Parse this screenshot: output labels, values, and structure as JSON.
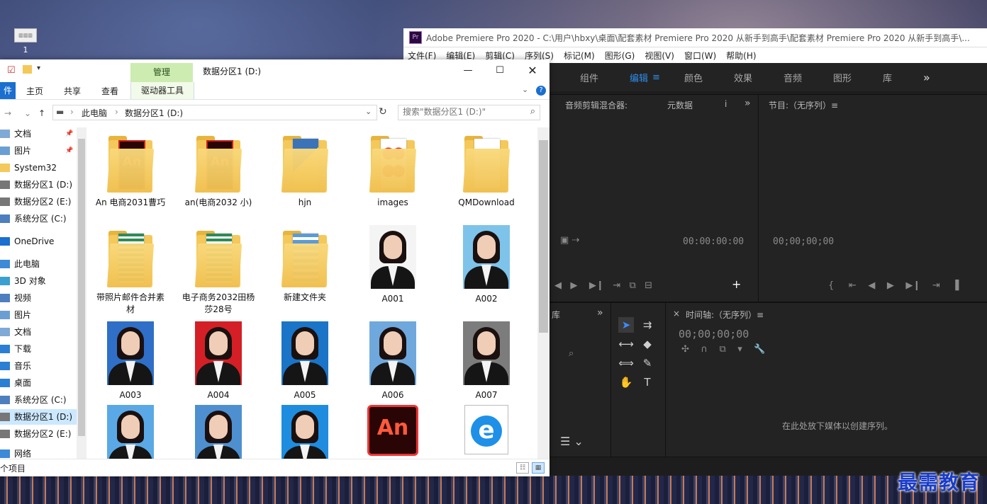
{
  "desktop": {
    "icon_label": "1",
    "watermark": "最需教育"
  },
  "premiere": {
    "window_title": "Adobe Premiere Pro 2020 - C:\\用户\\hbxy\\桌面\\配套素材 Premiere Pro 2020 从新手到高手\\配套素材 Premiere Pro 2020 从新手到高手\\...",
    "logo_text": "Pr",
    "menu": [
      "文件(F)",
      "编辑(E)",
      "剪辑(C)",
      "序列(S)",
      "标记(M)",
      "图形(G)",
      "视图(V)",
      "窗口(W)",
      "帮助(H)"
    ],
    "workspaces": [
      "组件",
      "编辑",
      "颜色",
      "效果",
      "音频",
      "图形",
      "库"
    ],
    "active_workspace": "编辑",
    "more_glyph": "»",
    "source_tabs": {
      "audio_mixer": "音频剪辑混合器:",
      "metadata": "元数据"
    },
    "program_tab": "节目:（无序列）≡",
    "source_timecode": "00:00:00:00",
    "program_timecode": "00;00;00;00",
    "project_tab": "库",
    "timeline_tab": "时间轴:（无序列）≡",
    "timeline_timecode": "00;00;00;00",
    "drop_hint": "在此处放下媒体以创建序列。"
  },
  "explorer": {
    "manage_tab": "管理",
    "title": "数据分区1 (D:)",
    "ribbon": {
      "file": "件",
      "home": "主页",
      "share": "共享",
      "view": "查看",
      "drive_tools": "驱动器工具"
    },
    "breadcrumb": [
      "此电脑",
      "数据分区1 (D:)"
    ],
    "search_placeholder": "搜索\"数据分区1 (D:)\"",
    "nav": [
      {
        "label": "文档",
        "icon": "document-icon",
        "color": "#7fa9d6"
      },
      {
        "label": "图片",
        "icon": "picture-icon",
        "color": "#6b9fd4"
      },
      {
        "label": "System32",
        "icon": "folder-icon",
        "color": "#f5c85a"
      },
      {
        "label": "数据分区1 (D:)",
        "icon": "drive-icon",
        "color": "#777777"
      },
      {
        "label": "数据分区2 (E:)",
        "icon": "drive-icon",
        "color": "#777777"
      },
      {
        "label": "系统分区 (C:)",
        "icon": "drive-icon",
        "color": "#4d7fbf"
      },
      {
        "label": "OneDrive",
        "icon": "cloud-icon",
        "color": "#1a6fcf"
      },
      {
        "label": "此电脑",
        "icon": "computer-icon",
        "color": "#3c8ad8"
      },
      {
        "label": "3D 对象",
        "icon": "cube-icon",
        "color": "#3aa0d0"
      },
      {
        "label": "视频",
        "icon": "video-icon",
        "color": "#4d7fbf"
      },
      {
        "label": "图片",
        "icon": "picture-icon",
        "color": "#6b9fd4"
      },
      {
        "label": "文档",
        "icon": "document-icon",
        "color": "#7fa9d6"
      },
      {
        "label": "下载",
        "icon": "download-icon",
        "color": "#2a7fd4"
      },
      {
        "label": "音乐",
        "icon": "music-icon",
        "color": "#2a7fd4"
      },
      {
        "label": "桌面",
        "icon": "desktop-icon",
        "color": "#2a7fd4"
      },
      {
        "label": "系统分区 (C:)",
        "icon": "drive-icon",
        "color": "#4d7fbf"
      },
      {
        "label": "数据分区1 (D:)",
        "icon": "drive-icon",
        "color": "#777777"
      },
      {
        "label": "数据分区2 (E:)",
        "icon": "drive-icon",
        "color": "#777777"
      },
      {
        "label": "网络",
        "icon": "network-icon",
        "color": "#3c8ad8"
      }
    ],
    "items": [
      {
        "label": "An 电商2031曹巧",
        "kind": "an-folder"
      },
      {
        "label": "an(电商2032 小)",
        "kind": "an-folder"
      },
      {
        "label": "hjn",
        "kind": "py-folder"
      },
      {
        "label": "images",
        "kind": "heart-folder"
      },
      {
        "label": "QMDownload",
        "kind": "folder"
      },
      {
        "label": "带照片邮件合并素材",
        "kind": "sheet-folder"
      },
      {
        "label": "电子商务2032田杨莎28号",
        "kind": "sheet-folder"
      },
      {
        "label": "新建文件夹",
        "kind": "blue-folder"
      },
      {
        "label": "A001",
        "kind": "photo",
        "bg": "#f4f4f4"
      },
      {
        "label": "A002",
        "kind": "photo",
        "bg": "#7ec3ea"
      },
      {
        "label": "A003",
        "kind": "photo",
        "bg": "#2f6fc7"
      },
      {
        "label": "A004",
        "kind": "photo",
        "bg": "#d41f26"
      },
      {
        "label": "A005",
        "kind": "photo",
        "bg": "#1a74c7"
      },
      {
        "label": "A006",
        "kind": "photo",
        "bg": "#6fa8dc"
      },
      {
        "label": "A007",
        "kind": "photo",
        "bg": "#7c7c7c"
      },
      {
        "label": "",
        "kind": "photo",
        "bg": "#5aa9e6"
      },
      {
        "label": "",
        "kind": "photo",
        "bg": "#4e8fd0"
      },
      {
        "label": "",
        "kind": "photo",
        "bg": "#1e8de0"
      },
      {
        "label": "",
        "kind": "an-file"
      },
      {
        "label": "",
        "kind": "ie-file"
      }
    ],
    "status": "个项目",
    "accent": "#1a6fcf"
  }
}
